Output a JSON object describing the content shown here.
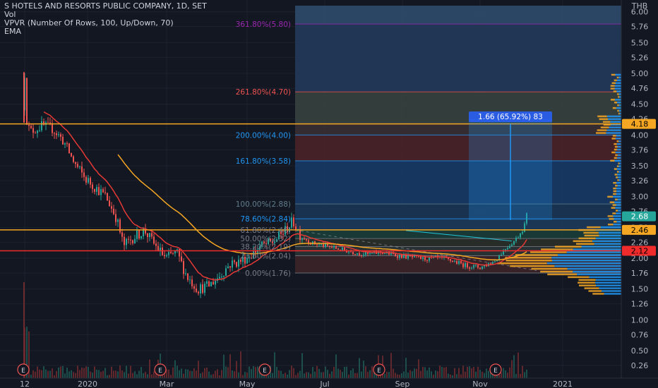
{
  "legend": {
    "title": "S HOTELS AND RESORTS PUBLIC COMPANY, 1D, SET",
    "line2": "Vol",
    "line3": "VPVR (Number Of Rows, 100, Up/Down, 70)",
    "line4": "EMA"
  },
  "currency": "THB",
  "colors": {
    "background": "#131722",
    "up": "#26a69a",
    "down": "#ef5350",
    "ema": "#e53935",
    "ema_slow": "#f5a623",
    "hline_orange": "#f5a623",
    "hline_red": "#ef2b2b",
    "measure": "#2196f3"
  },
  "chart_data": {
    "type": "candlestick",
    "y_ticks": [
      "6.00",
      "5.76",
      "5.50",
      "5.26",
      "5.00",
      "4.76",
      "4.50",
      "4.26",
      "4.00",
      "3.76",
      "3.50",
      "3.26",
      "3.00",
      "2.76",
      "2.50",
      "2.26",
      "2.00",
      "1.76",
      "1.50",
      "1.26",
      "1.00",
      "0.76",
      "0.50",
      "0.26"
    ],
    "x_ticks": [
      "12",
      "2020",
      "Mar",
      "May",
      "Jul",
      "Sep",
      "Nov",
      "2021"
    ],
    "ylim": [
      0,
      6.08
    ],
    "earnings_marker": "E",
    "price_markers": [
      {
        "text": "4.18",
        "value": 4.18,
        "color": "#f5a623"
      },
      {
        "text": "2.68",
        "value": 2.68,
        "color": "#26a69a"
      },
      {
        "text": "2.46",
        "value": 2.46,
        "color": "#f5a623"
      },
      {
        "text": "2.12",
        "value": 2.12,
        "color": "#ef2b2b"
      }
    ],
    "horizontal_lines": [
      {
        "value": 4.18,
        "color": "#f5a623"
      },
      {
        "value": 2.46,
        "color": "#f5a623"
      },
      {
        "value": 2.12,
        "color": "#ef2b2b"
      }
    ],
    "fib_levels": [
      {
        "label": "361.80%(5.80)",
        "value": 5.8,
        "color": "#9c27b0"
      },
      {
        "label": "261.80%(4.70)",
        "value": 4.7,
        "color": "#ef5350"
      },
      {
        "label": "200.00%(4.00)",
        "value": 4.0,
        "color": "#2196f3"
      },
      {
        "label": "161.80%(3.58)",
        "value": 3.58,
        "color": "#2196f3"
      },
      {
        "label": "100.00%(2.88)",
        "value": 2.88,
        "color": "#607d8b"
      },
      {
        "label": "78.60%(2.84)",
        "value": 2.64,
        "color": "#2196f3"
      },
      {
        "label": "61.80%(2.46)",
        "value": 2.46,
        "color": "#787b86"
      },
      {
        "label": "50.00%(2.32)",
        "value": 2.32,
        "color": "#787b86"
      },
      {
        "label": "38.20%(2.19)",
        "value": 2.19,
        "color": "#787b86"
      },
      {
        "label": "23.60%(2.04)",
        "value": 2.04,
        "color": "#787b86"
      },
      {
        "label": "0.00%(1.76)",
        "value": 1.76,
        "color": "#787b86"
      }
    ],
    "measure": {
      "label": "1.66 (65.92%) 83"
    }
  }
}
